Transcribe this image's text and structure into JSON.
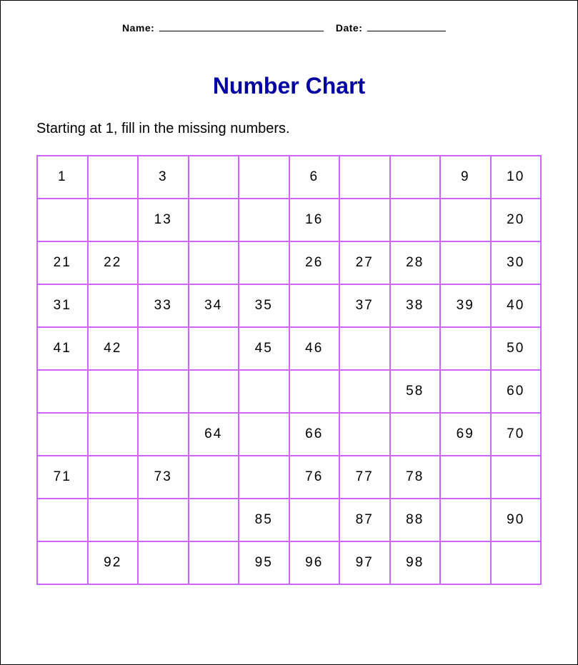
{
  "header": {
    "name_label": "Name:",
    "date_label": "Date:"
  },
  "title": "Number Chart",
  "instruction": "Starting at 1, fill in the missing numbers.",
  "grid": [
    [
      "1",
      "",
      "3",
      "",
      "",
      "6",
      "",
      "",
      "9",
      "10"
    ],
    [
      "",
      "",
      "13",
      "",
      "",
      "16",
      "",
      "",
      "",
      "20"
    ],
    [
      "21",
      "22",
      "",
      "",
      "",
      "26",
      "27",
      "28",
      "",
      "30"
    ],
    [
      "31",
      "",
      "33",
      "34",
      "35",
      "",
      "37",
      "38",
      "39",
      "40"
    ],
    [
      "41",
      "42",
      "",
      "",
      "45",
      "46",
      "",
      "",
      "",
      "50"
    ],
    [
      "",
      "",
      "",
      "",
      "",
      "",
      "",
      "58",
      "",
      "60"
    ],
    [
      "",
      "",
      "",
      "64",
      "",
      "66",
      "",
      "",
      "69",
      "70"
    ],
    [
      "71",
      "",
      "73",
      "",
      "",
      "76",
      "77",
      "78",
      "",
      ""
    ],
    [
      "",
      "",
      "",
      "",
      "85",
      "",
      "87",
      "88",
      "",
      "90"
    ],
    [
      "",
      "92",
      "",
      "",
      "95",
      "96",
      "97",
      "98",
      "",
      ""
    ]
  ]
}
